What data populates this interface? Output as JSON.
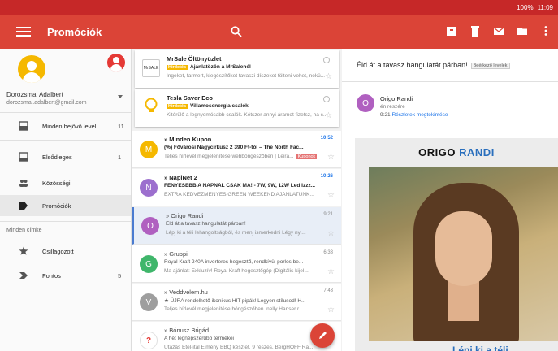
{
  "status_bar": {
    "text": "100%",
    "time": "11:09"
  },
  "app_bar": {
    "title": "Promóciók"
  },
  "drawer": {
    "account_name": "Dorozsmai Adalbert",
    "account_email": "dorozsmai.adalbert@gmail.com",
    "items": [
      {
        "label": "Minden bejövő levél",
        "count": "11"
      },
      {
        "label": "Elsődleges",
        "count": "1"
      },
      {
        "label": "Közösségi",
        "count": ""
      },
      {
        "label": "Promóciók",
        "count": ""
      }
    ],
    "section_label": "Minden címke",
    "labels": [
      {
        "label": "Csillagozott",
        "count": ""
      },
      {
        "label": "Fontos",
        "count": "5"
      }
    ]
  },
  "promo_cards": [
    {
      "sender": "MrSale Öltönyüzlet",
      "badge": "Hirdetés",
      "subject": "Ajánlatözön a MrSalenél",
      "snippet": "Ingeket, farmert, kiegészítőket tavaszi díszeket tölteni vehet, nekü..."
    },
    {
      "sender": "Tesla Saver Eco",
      "badge": "Hirdetés",
      "subject": "Villamosenergia csalók",
      "snippet": "Kitérülő a legnyomósabb csalók. Kétszer annyi áramot fizetsz, ha c..."
    }
  ],
  "emails": [
    {
      "initial": "M",
      "color": "#f5b800",
      "sender": "Minden Kupon",
      "time": "10:52",
      "subject": "(%) Fővárosi Nagycirkusz 2 390 Ft-tól – The North Fac...",
      "snippet": "Teljes hírlevél megjelenítése webböngészőben | Leira...",
      "label": "Kuponok",
      "unread": true
    },
    {
      "initial": "N",
      "color": "#9c6fce",
      "sender": "NapiNet 2",
      "time": "10:26",
      "subject": "FÉNYESEBB A NAPNÁL CSAK MA! - 7W, 9W, 12W Led Izzz...",
      "snippet": "EXTRA KEDVEZMÉNYES GREEN WEEKEND AJÁNLATUNK...",
      "label": "",
      "unread": true
    },
    {
      "initial": "O",
      "color": "#b060c0",
      "sender": "Origo Randi",
      "time": "9:21",
      "subject": "Éld át a tavasz hangulatát párban!",
      "snippet": "Lépj ki a téli lehangoltságból, és menj ismerkedni Légy nyi...",
      "label": "",
      "unread": false
    },
    {
      "initial": "G",
      "color": "#3fb66b",
      "sender": "Gruppi",
      "time": "6:33",
      "subject": "Royal Kraft 240A inverteres hegesztő, rendkívül porlos be...",
      "snippet": "Ma ajánlat: Exkluzív! Royal Kraft hegesztőgép (Digitális kijel...",
      "label": "",
      "unread": false
    },
    {
      "initial": "V",
      "color": "#9e9e9e",
      "sender": "Veddvelem.hu",
      "time": "7:43",
      "subject": "★ ÚJRA rendelhető ikonikus HIT pipák! Legyen stílusod! H...",
      "snippet": "Teljes hírlevél megjelenítése böngészőben. nelly Hanser r...",
      "label": "",
      "unread": false
    },
    {
      "initial": "?",
      "color": "#e53935",
      "sender": "Bónusz Brigád",
      "time": "",
      "subject": "A hét legnépszerűbb termékei",
      "snippet": "Utazás Étel-ital Élmény BBQ készlet, 9 részes, BergHOFF Ra...",
      "label": "",
      "unread": false
    }
  ],
  "reading_pane": {
    "subject": "Éld át a tavasz hangulatát párban!",
    "badge": "Beérkező levelek",
    "avatar_initial": "O",
    "from": "Origo Randi",
    "to": "én részére",
    "time": "9:21",
    "details_link": "Részletek megtekintése",
    "promo_brand_a": "ORIGO",
    "promo_brand_b": "RANDI",
    "promo_tagline": "...Lépj ki a téli..."
  },
  "colors": {
    "accent": "#db4437",
    "status_bar": "#c62828",
    "link": "#1a73e8"
  }
}
